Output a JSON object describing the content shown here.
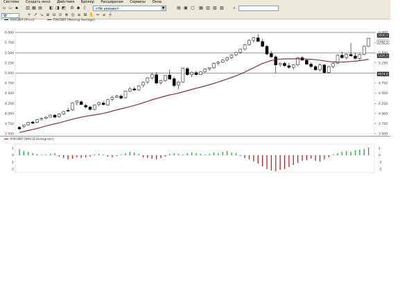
{
  "menu": [
    "Система",
    "Создать окно",
    "Действия",
    "Брокер",
    "Расширения",
    "Сервисы",
    "Окна"
  ],
  "toolbar": {
    "instrument_combo": "<Не указан>",
    "timeframe": "W",
    "tools": [
      "+",
      "↗",
      "↘",
      "⊕",
      "⊖",
      "⊙",
      "⊗",
      "◎",
      "≡",
      "⊞",
      "✋",
      "≈",
      "⌀",
      "┼"
    ]
  },
  "price_panel": {
    "legend_price": "ЛУКОЙЛ [Price]",
    "legend_ma": "ЛУКОЙЛ [Moving Average]",
    "y_ticks": [
      "6 000",
      "5 750",
      "5 500",
      "5 250",
      "5 000",
      "4 750",
      "4 500",
      "4 250",
      "4 000",
      "3 750",
      "3 500"
    ],
    "right_labels": [
      "5930.0",
      "5762.5",
      "5426.9",
      "4974.8"
    ],
    "colors": {
      "up_candle": "#ffffff",
      "down_candle": "#000000",
      "ma": "#7b1a3c",
      "grid": "#c0c0c0"
    }
  },
  "macd_panel": {
    "legend": "ЛУКОЙЛ [MACD Histogram]",
    "y_ticks": [
      "1",
      "0",
      "-1",
      "-2"
    ],
    "colors": {
      "positive": "#2e9e44",
      "negative": "#c0242b"
    }
  },
  "chart_data": {
    "type": "candlestick",
    "ylim": [
      3500,
      6000
    ],
    "candles": [
      [
        3660,
        3690,
        3590,
        3620
      ],
      [
        3680,
        3730,
        3640,
        3720
      ],
      [
        3720,
        3790,
        3700,
        3780
      ],
      [
        3790,
        3820,
        3740,
        3760
      ],
      [
        3780,
        3860,
        3760,
        3850
      ],
      [
        3860,
        3900,
        3820,
        3880
      ],
      [
        3880,
        3930,
        3860,
        3910
      ],
      [
        3910,
        3980,
        3900,
        3960
      ],
      [
        3960,
        3990,
        3880,
        3910
      ],
      [
        3920,
        4010,
        3900,
        3990
      ],
      [
        3990,
        4060,
        3970,
        4050
      ],
      [
        4080,
        4140,
        4040,
        4060
      ],
      [
        4090,
        4280,
        4060,
        4260
      ],
      [
        4270,
        4320,
        4200,
        4310
      ],
      [
        4290,
        4320,
        4220,
        4220
      ],
      [
        4200,
        4240,
        4130,
        4160
      ],
      [
        4160,
        4190,
        4070,
        4100
      ],
      [
        4100,
        4220,
        4080,
        4210
      ],
      [
        4220,
        4290,
        4180,
        4270
      ],
      [
        4260,
        4310,
        4200,
        4220
      ],
      [
        4210,
        4360,
        4190,
        4340
      ],
      [
        4350,
        4440,
        4310,
        4400
      ],
      [
        4400,
        4460,
        4380,
        4430
      ],
      [
        4430,
        4470,
        4350,
        4380
      ],
      [
        4390,
        4560,
        4370,
        4550
      ],
      [
        4550,
        4650,
        4520,
        4610
      ],
      [
        4610,
        4660,
        4560,
        4580
      ],
      [
        4580,
        4700,
        4560,
        4680
      ],
      [
        4700,
        4790,
        4650,
        4770
      ],
      [
        4780,
        4900,
        4730,
        4880
      ],
      [
        4880,
        5000,
        4840,
        4960
      ],
      [
        4960,
        5020,
        4730,
        4750
      ],
      [
        4760,
        4830,
        4710,
        4810
      ],
      [
        4810,
        4950,
        4790,
        4940
      ],
      [
        4950,
        5080,
        4840,
        4850
      ],
      [
        4860,
        4910,
        4650,
        4690
      ],
      [
        4700,
        4800,
        4600,
        4780
      ],
      [
        4780,
        5140,
        4760,
        5120
      ],
      [
        5110,
        5140,
        4930,
        4960
      ],
      [
        4960,
        5040,
        4900,
        5020
      ],
      [
        5010,
        5060,
        4940,
        4960
      ],
      [
        4960,
        5040,
        4950,
        5030
      ],
      [
        5030,
        5120,
        5010,
        5100
      ],
      [
        5100,
        5140,
        5060,
        5130
      ],
      [
        5130,
        5260,
        5110,
        5240
      ],
      [
        5240,
        5300,
        5200,
        5270
      ],
      [
        5270,
        5340,
        5250,
        5320
      ],
      [
        5320,
        5400,
        5290,
        5380
      ],
      [
        5380,
        5470,
        5350,
        5450
      ],
      [
        5450,
        5520,
        5420,
        5510
      ],
      [
        5510,
        5600,
        5480,
        5590
      ],
      [
        5590,
        5720,
        5560,
        5700
      ],
      [
        5700,
        5830,
        5680,
        5810
      ],
      [
        5810,
        5900,
        5750,
        5870
      ],
      [
        5870,
        5960,
        5830,
        5780
      ],
      [
        5780,
        5850,
        5640,
        5660
      ],
      [
        5660,
        5700,
        5440,
        5470
      ],
      [
        5480,
        5540,
        5380,
        5400
      ],
      [
        5400,
        5440,
        5000,
        5200
      ],
      [
        5210,
        5260,
        5160,
        5240
      ],
      [
        5240,
        5280,
        5150,
        5180
      ],
      [
        5180,
        5250,
        5100,
        5140
      ],
      [
        5140,
        5210,
        5080,
        5200
      ],
      [
        5200,
        5400,
        5180,
        5380
      ],
      [
        5380,
        5420,
        5300,
        5320
      ],
      [
        5320,
        5350,
        5200,
        5220
      ],
      [
        5220,
        5260,
        5120,
        5160
      ],
      [
        5160,
        5200,
        5060,
        5080
      ],
      [
        5080,
        5240,
        5040,
        5200
      ],
      [
        5200,
        5220,
        4990,
        5010
      ],
      [
        5010,
        5180,
        4990,
        5160
      ],
      [
        5160,
        5260,
        5120,
        5240
      ],
      [
        5240,
        5460,
        5220,
        5440
      ],
      [
        5440,
        5520,
        5360,
        5380
      ],
      [
        5380,
        5480,
        5340,
        5460
      ],
      [
        5460,
        5740,
        5420,
        5420
      ],
      [
        5420,
        5500,
        5340,
        5360
      ],
      [
        5360,
        5480,
        5300,
        5460
      ],
      [
        5460,
        5680,
        5440,
        5660
      ],
      [
        5660,
        5870,
        5640,
        5860
      ]
    ],
    "ma": [
      3530,
      3555,
      3580,
      3605,
      3630,
      3660,
      3690,
      3720,
      3745,
      3770,
      3800,
      3830,
      3860,
      3885,
      3910,
      3930,
      3950,
      3965,
      3985,
      4005,
      4030,
      4060,
      4090,
      4115,
      4140,
      4170,
      4200,
      4230,
      4265,
      4300,
      4340,
      4370,
      4400,
      4430,
      4460,
      4480,
      4505,
      4535,
      4565,
      4595,
      4625,
      4650,
      4680,
      4710,
      4745,
      4780,
      4815,
      4850,
      4890,
      4930,
      4975,
      5025,
      5080,
      5130,
      5185,
      5235,
      5275,
      5310,
      5330,
      5345,
      5350,
      5350,
      5350,
      5350,
      5350,
      5345,
      5340,
      5330,
      5315,
      5300,
      5285,
      5275,
      5270,
      5270,
      5275,
      5285,
      5295,
      5305,
      5320,
      5340
    ],
    "macd": [
      0.9,
      0.6,
      0.5,
      0.3,
      0.2,
      0.1,
      0.1,
      0.2,
      0.3,
      -0.2,
      -0.4,
      -0.6,
      -0.5,
      -0.3,
      -0.4,
      -0.3,
      -0.2,
      0.1,
      0.2,
      0.1,
      -0.2,
      -0.3,
      -0.1,
      0.1,
      0.3,
      0.5,
      0.4,
      0.2,
      -0.3,
      -0.4,
      -0.5,
      -0.6,
      -0.4,
      -0.2,
      0.2,
      0.3,
      0.2,
      0.1,
      0.3,
      0.4,
      0.3,
      0.2,
      0.1,
      0.2,
      0.4,
      0.3,
      0.5,
      0.6,
      0.4,
      0.3,
      -0.1,
      -0.4,
      -0.6,
      -0.9,
      -1.2,
      -1.6,
      -2.0,
      -2.2,
      -2.3,
      -2.1,
      -2.0,
      -1.7,
      -1.4,
      -1.1,
      -0.8,
      -0.7,
      -0.5,
      -0.8,
      -0.9,
      -0.6,
      -0.3,
      0.1,
      0.3,
      0.5,
      0.6,
      0.5,
      0.7,
      0.8,
      0.9,
      1.1
    ]
  }
}
